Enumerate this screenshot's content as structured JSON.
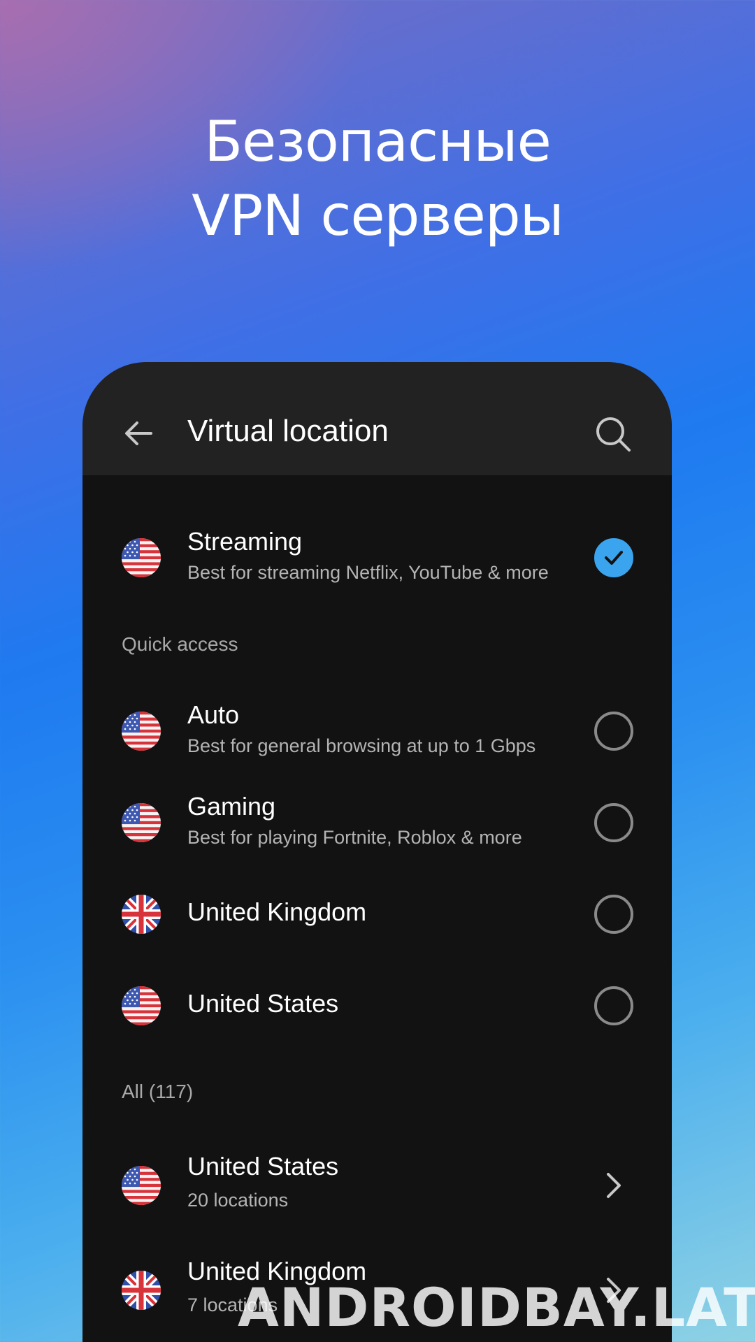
{
  "headline": {
    "line1": "Безопасные",
    "line2": "VPN серверы"
  },
  "appbar": {
    "title": "Virtual location",
    "back_icon": "arrow-left-icon",
    "search_icon": "search-icon"
  },
  "selected": {
    "title": "Streaming",
    "subtitle": "Best for streaming Netflix, YouTube & more",
    "flag": "us-flag-icon",
    "checked": true
  },
  "quick_access": {
    "label": "Quick access",
    "items": [
      {
        "title": "Auto",
        "subtitle": "Best for general browsing at up to 1 Gbps",
        "flag": "us-flag-icon"
      },
      {
        "title": "Gaming",
        "subtitle": "Best for playing Fortnite, Roblox & more",
        "flag": "us-flag-icon"
      },
      {
        "title": "United Kingdom",
        "subtitle": "",
        "flag": "uk-flag-icon"
      },
      {
        "title": "United States",
        "subtitle": "",
        "flag": "us-flag-icon"
      }
    ]
  },
  "all": {
    "label": "All (117)",
    "items": [
      {
        "title": "United States",
        "subtitle": "20 locations",
        "flag": "us-flag-icon"
      },
      {
        "title": "United Kingdom",
        "subtitle": "7 locations",
        "flag": "uk-flag-icon"
      }
    ]
  },
  "watermark": "ANDROIDBAY.LAT",
  "colors": {
    "accent": "#3aa5ee",
    "panel": "#121212",
    "appbar": "#222222"
  }
}
